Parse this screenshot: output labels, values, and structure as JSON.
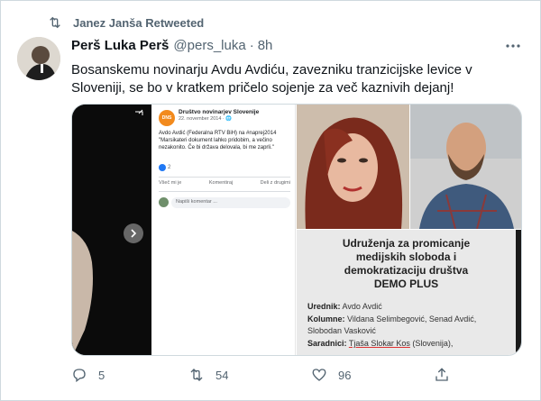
{
  "retweet": {
    "label": "Janez Janša Retweeted",
    "icon": "retweet-icon"
  },
  "tweet": {
    "author_name": "Perš Luka Perš",
    "handle": "@pers_luka",
    "separator": "·",
    "time": "8h",
    "text": "Bosanskemu novinarju Avdu Avdiću, zavezniku tranzicijske levice v Sloveniji, se bo v kratkem pričelo sojenje za več kaznivih dejanj!"
  },
  "media": {
    "fb_post": {
      "logo_text": "DNS",
      "page_name": "Društvo novinarjev Slovenije",
      "date": "22. november 2014 · 🌐",
      "body": "Avdo Avdić (Federalna RTV BiH) na #naprej2014 \"Marsikateri dokument lahko pridobim, a večino nezakonito. Če bi država delovala, bi me zaprli.\"",
      "reactions": "2",
      "action_like": "Všeč mi je",
      "action_comment": "Komentiraj",
      "action_share": "Deli z drugimi",
      "comment_placeholder": "Napiši komentar ..."
    },
    "document": {
      "title_line1": "Udruženja za promicanje",
      "title_line2": "medijskih sloboda i",
      "title_line3": "demokratizaciju društva",
      "title_line4": "DEMO PLUS",
      "editor_label": "Urednik:",
      "editor_value": "Avdo Avdić",
      "columns_label": "Kolumne:",
      "columns_value": "Vildana Selimbegović, Senad Avdić,",
      "columns_value2": "Slobodan Vasković",
      "contrib_label": "Saradnici:",
      "contrib_value": "Tjaša Slokar Kos",
      "contrib_suffix": "(Slovenija),"
    }
  },
  "actions": {
    "replies": "5",
    "retweets": "54",
    "likes": "96"
  },
  "colors": {
    "secondary_text": "#536471",
    "primary_text": "#0f1419",
    "border": "#cfd9de"
  }
}
